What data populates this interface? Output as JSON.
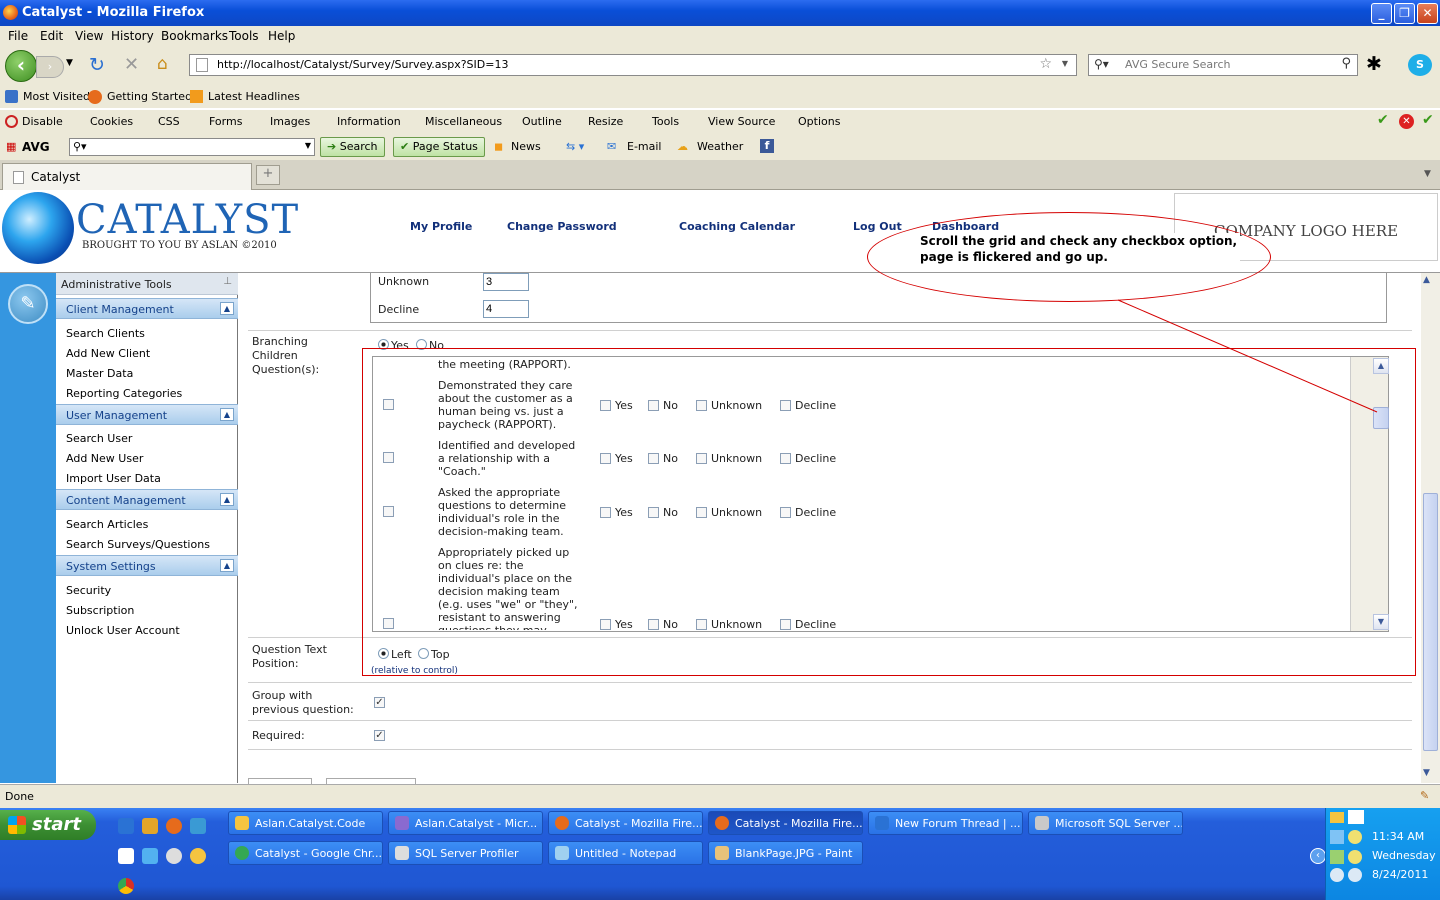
{
  "window": {
    "title": "Catalyst - Mozilla Firefox"
  },
  "menu": [
    "File",
    "Edit",
    "View",
    "History",
    "Bookmarks",
    "Tools",
    "Help"
  ],
  "nav": {
    "url": "http://localhost/Catalyst/Survey/Survey.aspx?SID=13",
    "search_placeholder": "AVG Secure Search"
  },
  "bookmarks": [
    "Most Visited",
    "Getting Started",
    "Latest Headlines"
  ],
  "webdev": [
    "Disable",
    "Cookies",
    "CSS",
    "Forms",
    "Images",
    "Information",
    "Miscellaneous",
    "Outline",
    "Resize",
    "Tools",
    "View Source",
    "Options"
  ],
  "avg": {
    "brand": "AVG",
    "search": "Search",
    "page_status": "Page Status",
    "news": "News",
    "email": "E-mail",
    "weather": "Weather"
  },
  "tab": {
    "label": "Catalyst"
  },
  "header": {
    "logo": "CATALYST",
    "logo_sub": "BROUGHT TO YOU BY ASLAN ©2010",
    "links": [
      "My Profile",
      "Change Password",
      "Coaching Calendar",
      "Log Out",
      "Dashboard"
    ],
    "company_logo": "COMPANY LOGO HERE"
  },
  "sidebar": {
    "title": "Administrative Tools",
    "sections": [
      {
        "title": "Client Management",
        "items": [
          "Search Clients",
          "Add New Client",
          "Master Data",
          "Reporting Categories"
        ]
      },
      {
        "title": "User Management",
        "items": [
          "Search User",
          "Add New User",
          "Import User Data"
        ]
      },
      {
        "title": "Content Management",
        "items": [
          "Search Articles",
          "Search Surveys/Questions"
        ]
      },
      {
        "title": "System Settings",
        "items": [
          "Security",
          "Subscription",
          "Unlock User Account"
        ]
      }
    ]
  },
  "form": {
    "unknown_label": "Unknown",
    "unknown_value": "3",
    "decline_label": "Decline",
    "decline_value": "4",
    "branching_label": "Branching Children Question(s):",
    "yes": "Yes",
    "no": "No",
    "grid_top_text": "the meeting (RAPPORT).",
    "options": [
      "Yes",
      "No",
      "Unknown",
      "Decline"
    ],
    "questions": [
      "Demonstrated they care about the customer as a human being vs. just a paycheck (RAPPORT).",
      "Identified and developed a relationship with a \"Coach.\"",
      "Asked the appropriate questions to determine individual's role in the decision-making team.",
      "Appropriately picked up on clues re: the individual's place on the decision making team (e.g. uses \"we\" or \"they\", resistant to answering questions they may reveal"
    ],
    "qtext_position_label": "Question Text Position:",
    "left": "Left",
    "top": "Top",
    "relative_note": "(relative to control)",
    "group_label": "Group with previous question:",
    "required_label": "Required:"
  },
  "annotation": {
    "text": "Scroll the grid and check any checkbox option, page is flickered and go up."
  },
  "status": {
    "text": "Done"
  },
  "taskbar": {
    "start": "start",
    "row1": [
      "Aslan.Catalyst.Code",
      "Aslan.Catalyst - Micr...",
      "Catalyst - Mozilla Fire...",
      "Catalyst - Mozilla Fire...",
      "New Forum Thread | ...",
      "Microsoft SQL Server ..."
    ],
    "row2": [
      "Catalyst - Google Chr...",
      "SQL Server Profiler",
      "Untitled - Notepad",
      "BlankPage.JPG - Paint"
    ],
    "time": "11:34 AM",
    "day": "Wednesday",
    "date": "8/24/2011"
  },
  "colors": {
    "accent": "#15428b",
    "sidebar_blue": "#3596e0",
    "annotation_red": "#d40000"
  }
}
